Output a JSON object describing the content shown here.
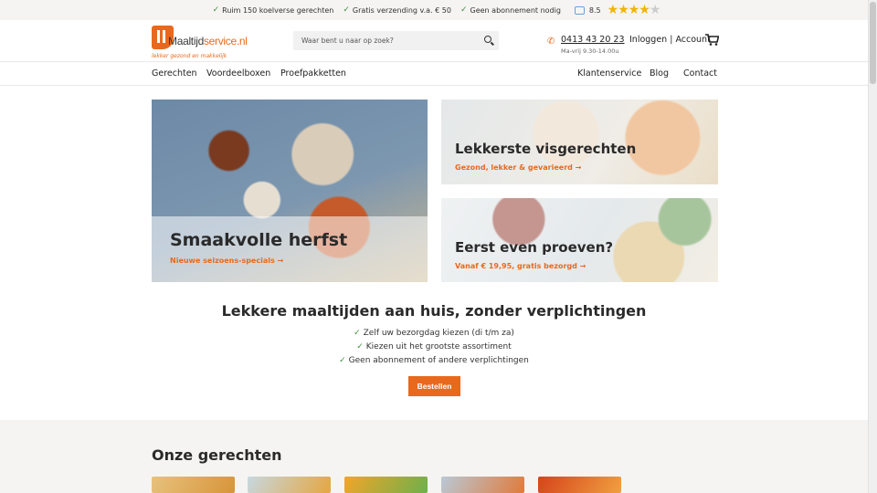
{
  "usp_bar": {
    "items": [
      "Ruim 150 koelverse gerechten",
      "Gratis verzending v.a. € 50",
      "Geen abonnement nodig"
    ],
    "rating_score": "8.5",
    "stars": 4.5,
    "star_color": "#f0b400"
  },
  "header": {
    "logo": {
      "name_part1": "Maaltijd",
      "name_part2": "service.nl",
      "tagline": "lekker gezond en makkelijk"
    },
    "search": {
      "placeholder": "Waar bent u naar op zoek?"
    },
    "phone": "0413 43 20 23",
    "hours": "Ma-vrij 9.30-14.00u",
    "account": "Inloggen | Account",
    "icons": [
      "search-icon",
      "phone-icon",
      "cart-icon"
    ]
  },
  "nav": {
    "left": [
      "Gerechten",
      "Voordeelboxen",
      "Proefpakketten"
    ],
    "right": [
      "Klantenservice",
      "Blog",
      "Contact"
    ]
  },
  "hero": {
    "big": {
      "title": "Smaakvolle herfst",
      "link": "Nieuwe seizoens-specials →"
    },
    "fish": {
      "title": "Lekkerste visgerechten",
      "link": "Gezond, lekker & gevarieerd →"
    },
    "try": {
      "title": "Eerst even proeven?",
      "link": "Vanaf € 19,95, gratis bezorgd →"
    }
  },
  "promo": {
    "title": "Lekkere maaltijden aan huis, zonder verplichtingen",
    "bullets": [
      "Zelf uw bezorgdag kiezen (di t/m za)",
      "Kiezen uit het grootste assortiment",
      "Geen abonnement of andere verplichtingen"
    ],
    "button": "Bestellen"
  },
  "dishes": {
    "title": "Onze gerechten"
  },
  "colors": {
    "accent": "#e8691e",
    "check": "#3f8f3f"
  }
}
